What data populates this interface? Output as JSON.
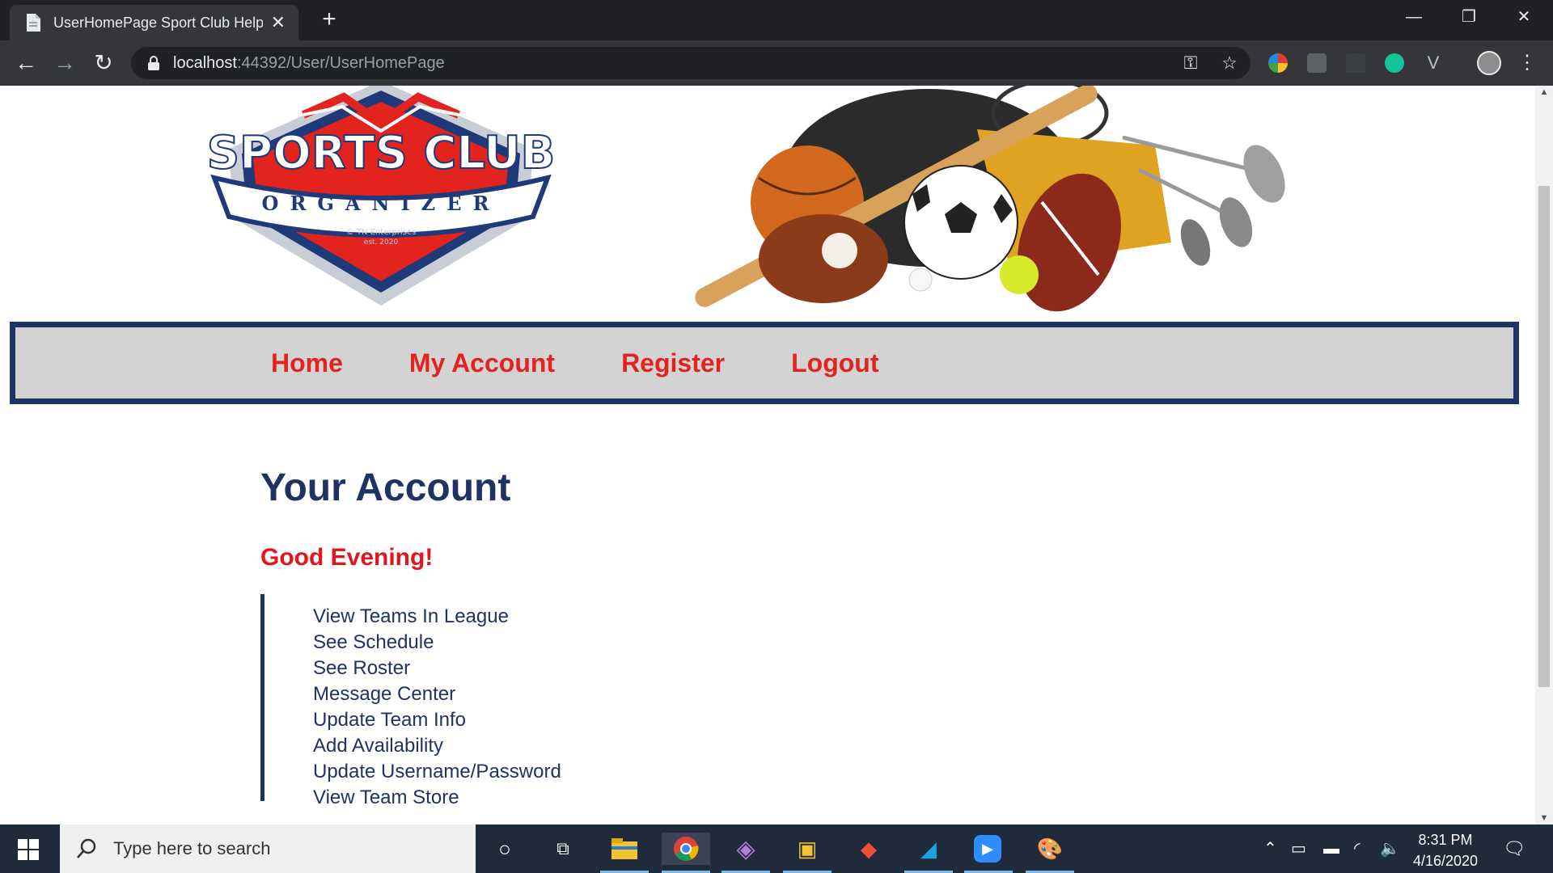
{
  "browser": {
    "tab_title": "UserHomePage Sport Club Helpe",
    "url_host": "localhost",
    "url_path": ":44392/User/UserHomePage"
  },
  "nav": {
    "items": [
      "Home",
      "My Account",
      "Register",
      "Logout"
    ]
  },
  "page": {
    "heading": "Your Account",
    "greeting": "Good Evening!",
    "links": [
      "View Teams In League",
      "See Schedule",
      "See Roster",
      "Message Center",
      "Update Team Info",
      "Add Availability",
      "Update Username/Password",
      "View Team Store"
    ]
  },
  "logo": {
    "line1": "SPORTS CLUB",
    "line2": "ORGANIZER",
    "line3": "© TN Enterprises",
    "line4": "est. 2020"
  },
  "taskbar": {
    "search_placeholder": "Type here to search",
    "time": "8:31 PM",
    "date": "4/16/2020"
  },
  "colors": {
    "navy": "#1f3264",
    "red": "#e3231d",
    "nav_bg": "#d3d3d3"
  }
}
